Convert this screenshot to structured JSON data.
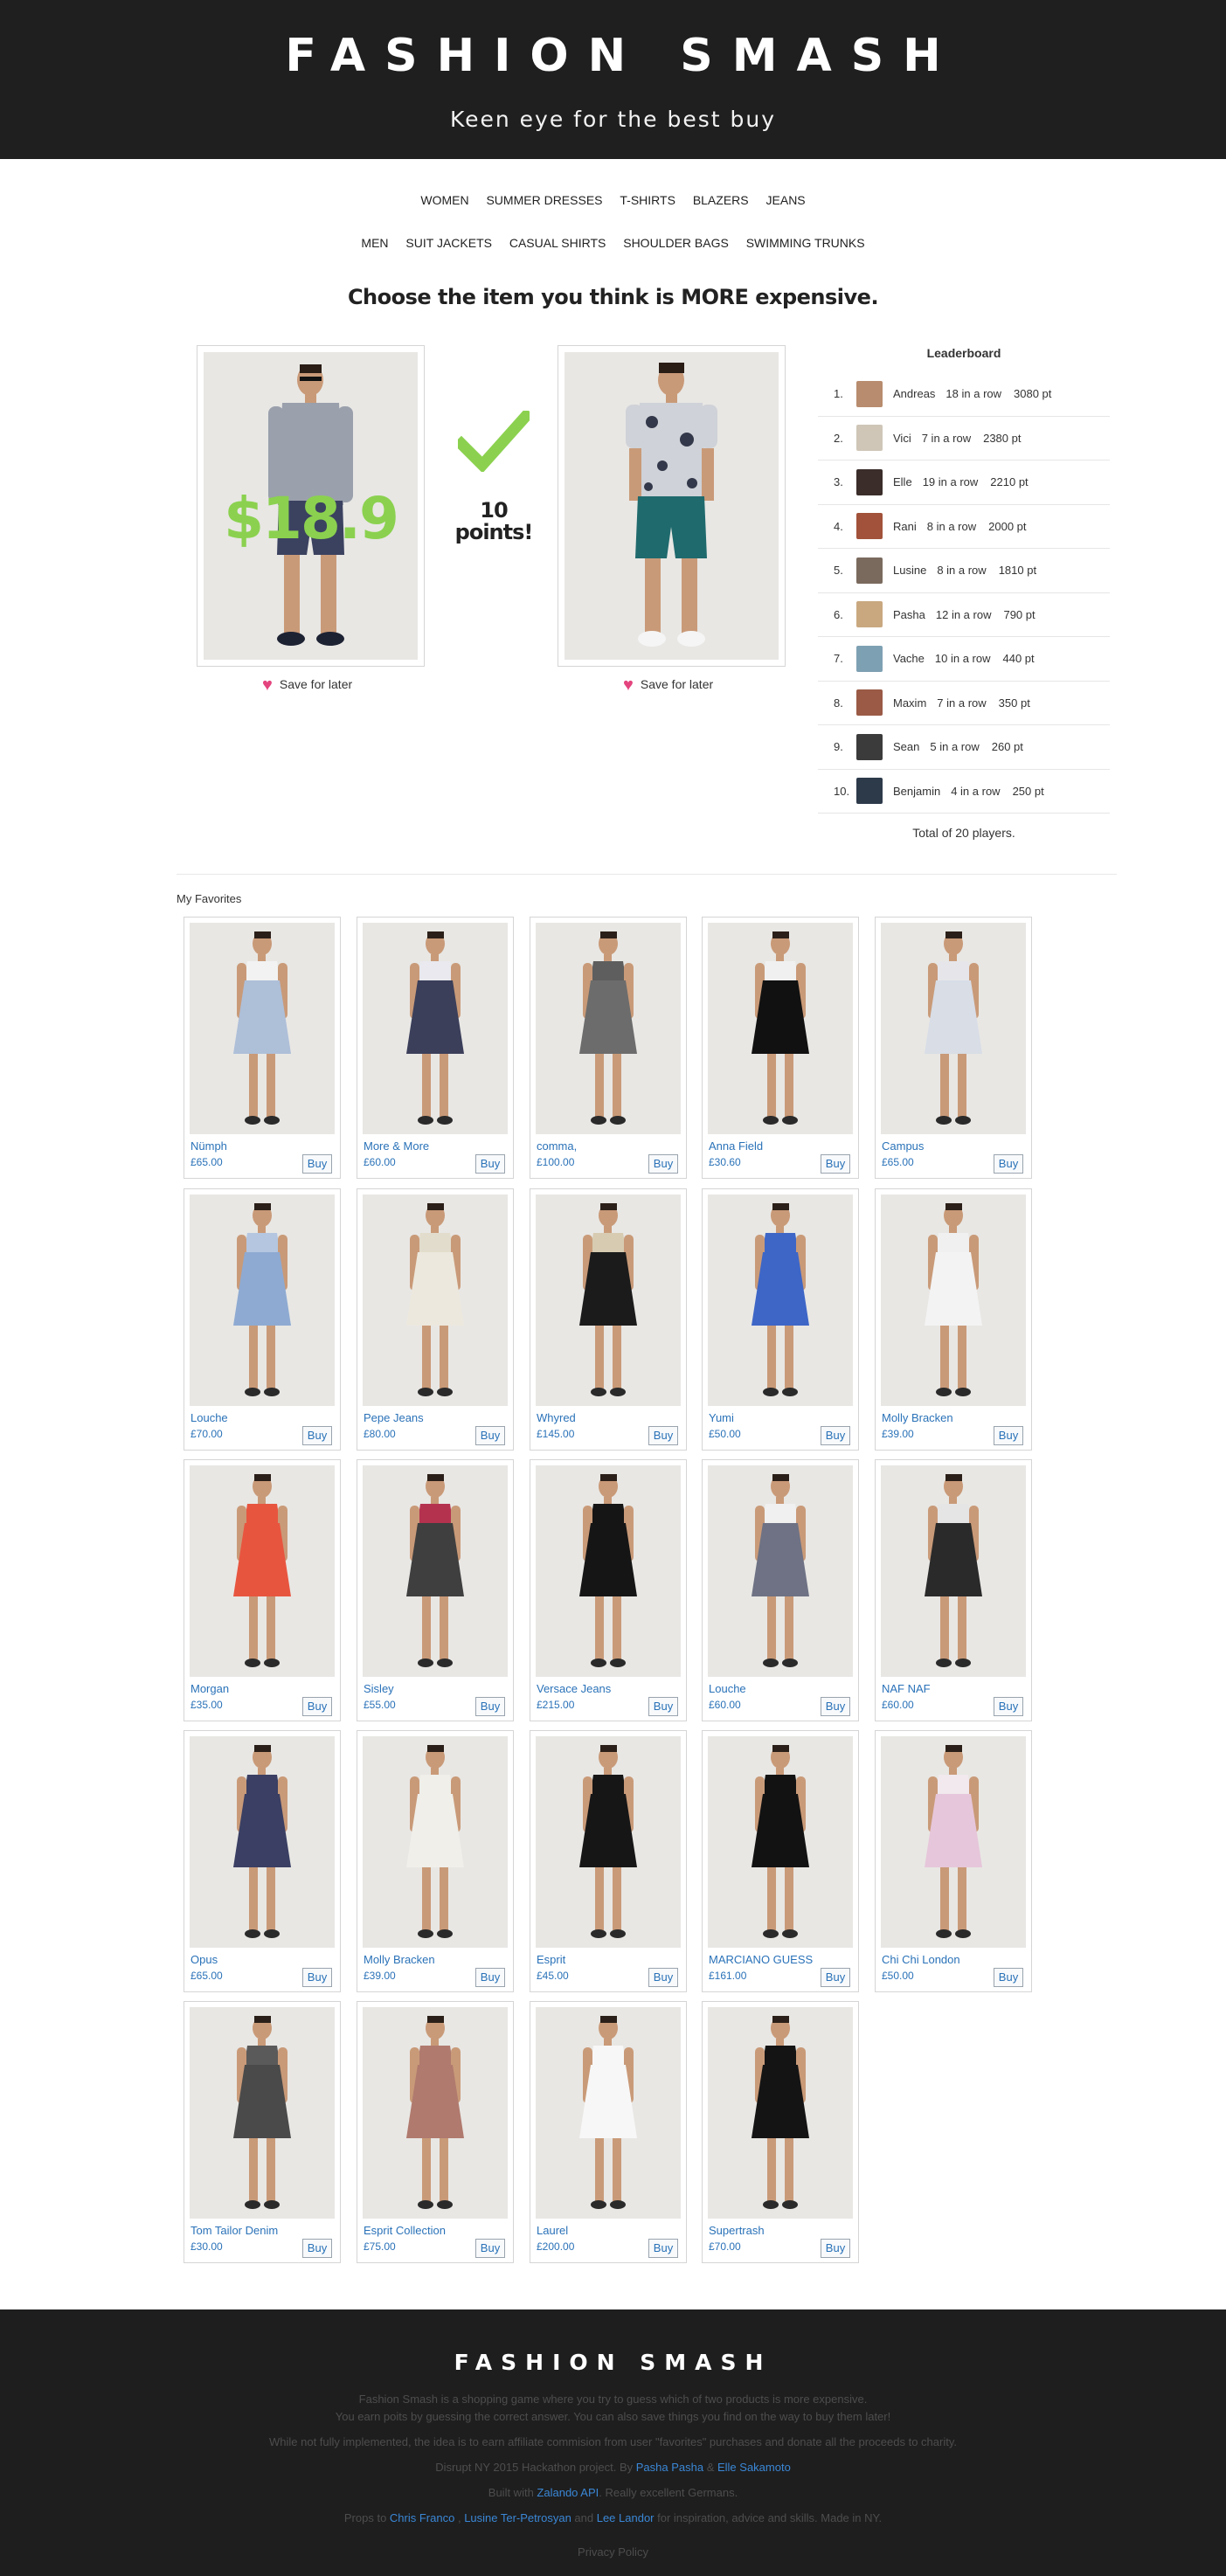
{
  "header": {
    "brand": "FASHION SMASH",
    "tagline": "Keen eye for the best buy"
  },
  "nav": {
    "row1": [
      "WOMEN",
      "SUMMER DRESSES",
      "T-SHIRTS",
      "BLAZERS",
      "JEANS"
    ],
    "row2": [
      "MEN",
      "SUIT JACKETS",
      "CASUAL SHIRTS",
      "SHOULDER BAGS",
      "SWIMMING TRUNKS"
    ]
  },
  "game": {
    "question": "Choose the item you think is MORE expensive.",
    "left_price": "$18.9",
    "points_line1": "10",
    "points_line2": "points!",
    "save_label": "Save for later",
    "check_color": "#8bd14f"
  },
  "leaderboard": {
    "title": "Leaderboard",
    "rows": [
      {
        "rank": "1.",
        "name": "Andreas",
        "streak": "18 in a row",
        "points": "3080 pt",
        "avatar_color": "#b88c6e"
      },
      {
        "rank": "2.",
        "name": "Vici",
        "streak": "7 in a row",
        "points": "2380 pt",
        "avatar_color": "#cfc6b8"
      },
      {
        "rank": "3.",
        "name": "Elle",
        "streak": "19 in a row",
        "points": "2210 pt",
        "avatar_color": "#3a2d2a"
      },
      {
        "rank": "4.",
        "name": "Rani",
        "streak": "8 in a row",
        "points": "2000 pt",
        "avatar_color": "#a2523a"
      },
      {
        "rank": "5.",
        "name": "Lusine",
        "streak": "8 in a row",
        "points": "1810 pt",
        "avatar_color": "#7a6a5e"
      },
      {
        "rank": "6.",
        "name": "Pasha",
        "streak": "12 in a row",
        "points": "790 pt",
        "avatar_color": "#c9a880"
      },
      {
        "rank": "7.",
        "name": "Vache",
        "streak": "10 in a row",
        "points": "440 pt",
        "avatar_color": "#7ea0b3"
      },
      {
        "rank": "8.",
        "name": "Maxim",
        "streak": "7 in a row",
        "points": "350 pt",
        "avatar_color": "#9a5a45"
      },
      {
        "rank": "9.",
        "name": "Sean",
        "streak": "5 in a row",
        "points": "260 pt",
        "avatar_color": "#3b3b3b"
      },
      {
        "rank": "10.",
        "name": "Benjamin",
        "streak": "4 in a row",
        "points": "250 pt",
        "avatar_color": "#2d3a4a"
      }
    ],
    "total": "Total of 20 players."
  },
  "favorites": {
    "title": "My Favorites",
    "buy_label": "Buy",
    "items": [
      {
        "brand": "Nümph",
        "price": "£65.00",
        "dress": "#aebfd8",
        "top": "#f2f2f2"
      },
      {
        "brand": "More & More",
        "price": "£60.00",
        "dress": "#3b3f5a",
        "top": "#e9e9ef"
      },
      {
        "brand": "comma,",
        "price": "£100.00",
        "dress": "#6c6c6c",
        "top": "#5e5e5e"
      },
      {
        "brand": "Anna Field",
        "price": "£30.60",
        "dress": "#111111",
        "top": "#f0f0f0"
      },
      {
        "brand": "Campus",
        "price": "£65.00",
        "dress": "#d8dde6",
        "top": "#e6e6ea"
      },
      {
        "brand": "Louche",
        "price": "£70.00",
        "dress": "#8eaad2",
        "top": "#b4c6e0"
      },
      {
        "brand": "Pepe Jeans",
        "price": "£80.00",
        "dress": "#ece8dd",
        "top": "#e2dccc"
      },
      {
        "brand": "Whyred",
        "price": "£145.00",
        "dress": "#1b1b1b",
        "top": "#d7cbb1"
      },
      {
        "brand": "Yumi",
        "price": "£50.00",
        "dress": "#3d66c7",
        "top": "#3d66c7"
      },
      {
        "brand": "Molly Bracken",
        "price": "£39.00",
        "dress": "#f3f3f3",
        "top": "#f0f0f0"
      },
      {
        "brand": "Morgan",
        "price": "£35.00",
        "dress": "#e8553f",
        "top": "#e8553f"
      },
      {
        "brand": "Sisley",
        "price": "£55.00",
        "dress": "#3f3f3f",
        "top": "#b5324f"
      },
      {
        "brand": "Versace Jeans",
        "price": "£215.00",
        "dress": "#151515",
        "top": "#151515"
      },
      {
        "brand": "Louche",
        "price": "£60.00",
        "dress": "#6e7284",
        "top": "#f0f0f0"
      },
      {
        "brand": "NAF NAF",
        "price": "£60.00",
        "dress": "#2a2a2a",
        "top": "#e5e5e5"
      },
      {
        "brand": "Opus",
        "price": "£65.00",
        "dress": "#3a3f63",
        "top": "#3a3f63"
      },
      {
        "brand": "Molly Bracken",
        "price": "£39.00",
        "dress": "#f0efea",
        "top": "#f0efea"
      },
      {
        "brand": "Esprit",
        "price": "£45.00",
        "dress": "#161616",
        "top": "#161616"
      },
      {
        "brand": "MARCIANO GUESS",
        "price": "£161.00",
        "dress": "#121212",
        "top": "#121212"
      },
      {
        "brand": "Chi Chi London",
        "price": "£50.00",
        "dress": "#e6c6da",
        "top": "#f1e9ee"
      },
      {
        "brand": "Tom Tailor Denim",
        "price": "£30.00",
        "dress": "#4a4a4a",
        "top": "#5a5a5a"
      },
      {
        "brand": "Esprit Collection",
        "price": "£75.00",
        "dress": "#b07a6e",
        "top": "#b07a6e"
      },
      {
        "brand": "Laurel",
        "price": "£200.00",
        "dress": "#f7f7f7",
        "top": "#f7f7f7"
      },
      {
        "brand": "Supertrash",
        "price": "£70.00",
        "dress": "#141414",
        "top": "#141414"
      }
    ]
  },
  "footer": {
    "brand": "FASHION SMASH",
    "line1": "Fashion Smash is a shopping game where you try to guess which of two products is more expensive.",
    "line2": "You earn poits by guessing the correct answer. You can also save things you find on the way to buy them later!",
    "line3": "While not fully implemented, the idea is to earn affiliate commision from user \"favorites\" purchases and donate all the proceeds to charity.",
    "line4_pre": "Disrupt NY 2015 Hackathon project. By ",
    "line4_link1": "Pasha Pasha",
    "line4_amp": " & ",
    "line4_link2": "Elle Sakamoto",
    "line5_pre": "Built with ",
    "line5_link": "Zalando API",
    "line5_post": ". Really excellent Germans.",
    "line6_pre": "Props to ",
    "line6_link1": "Chris Franco",
    "line6_sep1": " , ",
    "line6_link2": "Lusine Ter-Petrosyan",
    "line6_sep2": " and ",
    "line6_link3": "Lee Landor",
    "line6_post": " for inspiration, advice and skills. Made in NY.",
    "privacy": "Privacy Policy"
  }
}
